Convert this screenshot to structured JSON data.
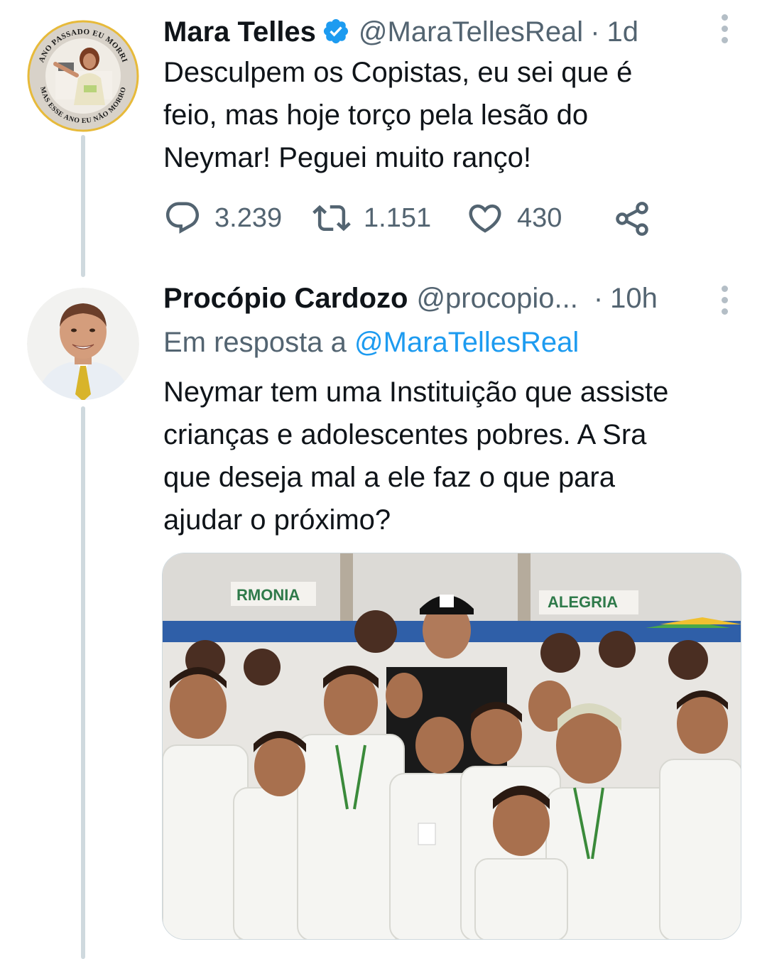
{
  "tweets": [
    {
      "author_name": "Mara Telles",
      "handle": "@MaraTellesReal",
      "separator": "·",
      "time": "1d",
      "verified": true,
      "avatar_icon": "circular-badge-avatar",
      "avatar_ring_text_top": "ANO PASSADO EU MORRI",
      "avatar_ring_text_bottom": "MAS ESSE ANO EU NÃO MORRO",
      "text_lines": [
        "Desculpem os Copistas, eu sei que é",
        "feio, mas hoje torço pela lesão do",
        "Neymar! Peguei muito ranço!"
      ],
      "replies": "3.239",
      "retweets": "1.151",
      "likes": "430",
      "icons": {
        "reply": "reply-icon",
        "retweet": "retweet-icon",
        "like": "heart-icon",
        "share": "share-icon",
        "more": "more-vertical-icon"
      }
    },
    {
      "author_name": "Procópio Cardozo",
      "handle": "@procopio...",
      "separator": "·",
      "time": "10h",
      "reply_prefix": "Em resposta a",
      "reply_mention": "@MaraTellesReal",
      "text_lines": [
        "Neymar tem uma Instituição que assiste",
        "crianças e adolescentes pobres. A Sra",
        "que deseja mal a ele faz o que para",
        "ajudar o próximo?"
      ],
      "media_banner_left": "RMONIA",
      "media_banner_right": "ALEGRIA",
      "media_icon": "photo-group-kids"
    }
  ],
  "colors": {
    "text": "#0f1419",
    "secondary": "#536471",
    "link": "#1d9bf0",
    "thread_line": "#cfd9de",
    "verified": "#1d9bf0"
  }
}
